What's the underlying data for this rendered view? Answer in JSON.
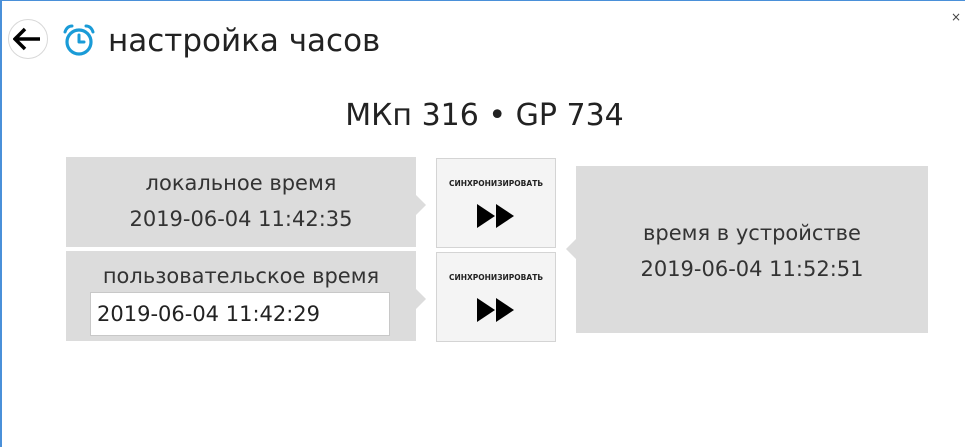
{
  "header": {
    "title": "настройка часов",
    "back_icon": "arrow-left-icon",
    "clock_icon": "alarm-clock-icon",
    "close_label": "×"
  },
  "device": {
    "title": "МКп 316 • GP 734"
  },
  "local_time": {
    "label": "локальное время",
    "value": "2019-06-04 11:42:35"
  },
  "user_time": {
    "label": "пользовательское время",
    "value": "2019-06-04 11:42:29"
  },
  "device_time": {
    "label": "время в устройстве",
    "value": "2019-06-04 11:52:51"
  },
  "sync_buttons": [
    {
      "label": "СИНХРОНИЗИРОВАТЬ",
      "icon": "fast-forward-icon"
    },
    {
      "label": "СИНХРОНИЗИРОВАТЬ",
      "icon": "fast-forward-icon"
    }
  ],
  "colors": {
    "accent": "#1a9bd7",
    "panel_bg": "#dcdcdc",
    "window_border": "#4a90d9"
  }
}
